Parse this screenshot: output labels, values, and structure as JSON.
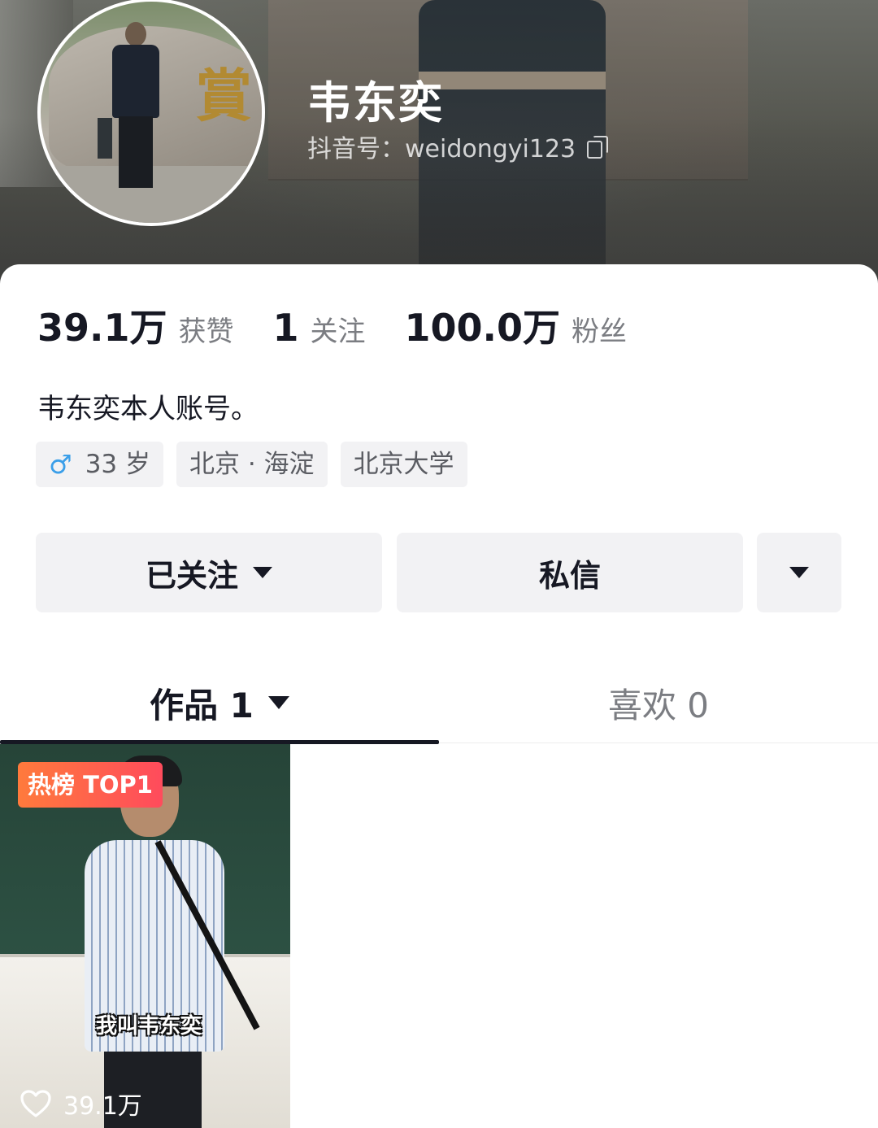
{
  "profile": {
    "name": "韦东奕",
    "douyin_id": "抖音号：weidongyi123",
    "bio": "韦东奕本人账号。"
  },
  "stats": [
    {
      "value": "39.1万",
      "label": "获赞"
    },
    {
      "value": "1",
      "label": "关注"
    },
    {
      "value": "100.0万",
      "label": "粉丝"
    }
  ],
  "tags": {
    "age": "33 岁",
    "location": "北京 · 海淀",
    "school": "北京大学"
  },
  "buttons": {
    "follow": "已关注",
    "message": "私信"
  },
  "tabs": {
    "works": "作品 1",
    "likes": "喜欢 0"
  },
  "video": {
    "badge": "热榜 TOP1",
    "caption": "我叫韦东奕",
    "likes": "39.1万"
  },
  "colors": {
    "accent_male": "#3b9fe9",
    "badge_gradient": [
      "#ff7a3c",
      "#ff4b5c"
    ],
    "text_primary": "#161823",
    "text_secondary": "#7b7d82"
  },
  "icons": [
    "copy-icon",
    "male-icon",
    "dropdown-arrow-icon",
    "heart-icon"
  ]
}
